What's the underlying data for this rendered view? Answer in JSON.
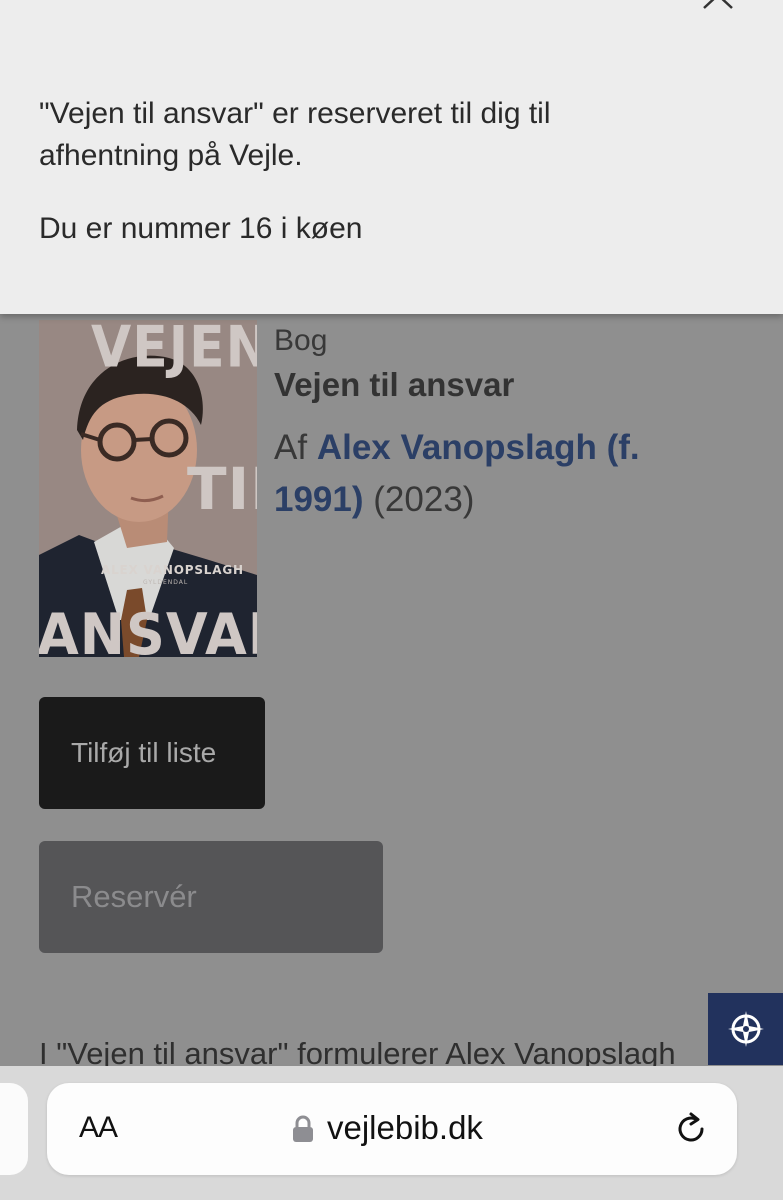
{
  "banner": {
    "message": "\"Vejen til ansvar\" er reserveret til dig til afhentning på Vejle.",
    "queue": "Du er nummer 16 i køen"
  },
  "book": {
    "cover": {
      "word_top": "VEJEN",
      "word_mid": "TIL",
      "word_bottom": "ANSVAR",
      "author_caps": "ALEX VANOPSLAGH",
      "publisher": "GYLDENDAL"
    },
    "type": "Bog",
    "title": "Vejen til ansvar",
    "by": "Af",
    "author_link": "Alex Vanopslagh (f. 1991)",
    "year": "(2023)"
  },
  "actions": {
    "add_to_list": "Tilføj til liste",
    "reserve": "Reservér"
  },
  "description": {
    "snippet": "I \"Vejen til ansvar\" formulerer Alex Vanopslagh"
  },
  "browser": {
    "text_size": "AA",
    "url": "vejlebib.dk"
  },
  "colors": {
    "link": "#2b3f66",
    "badge": "#22325d",
    "overlay": "#8f8f8f"
  }
}
